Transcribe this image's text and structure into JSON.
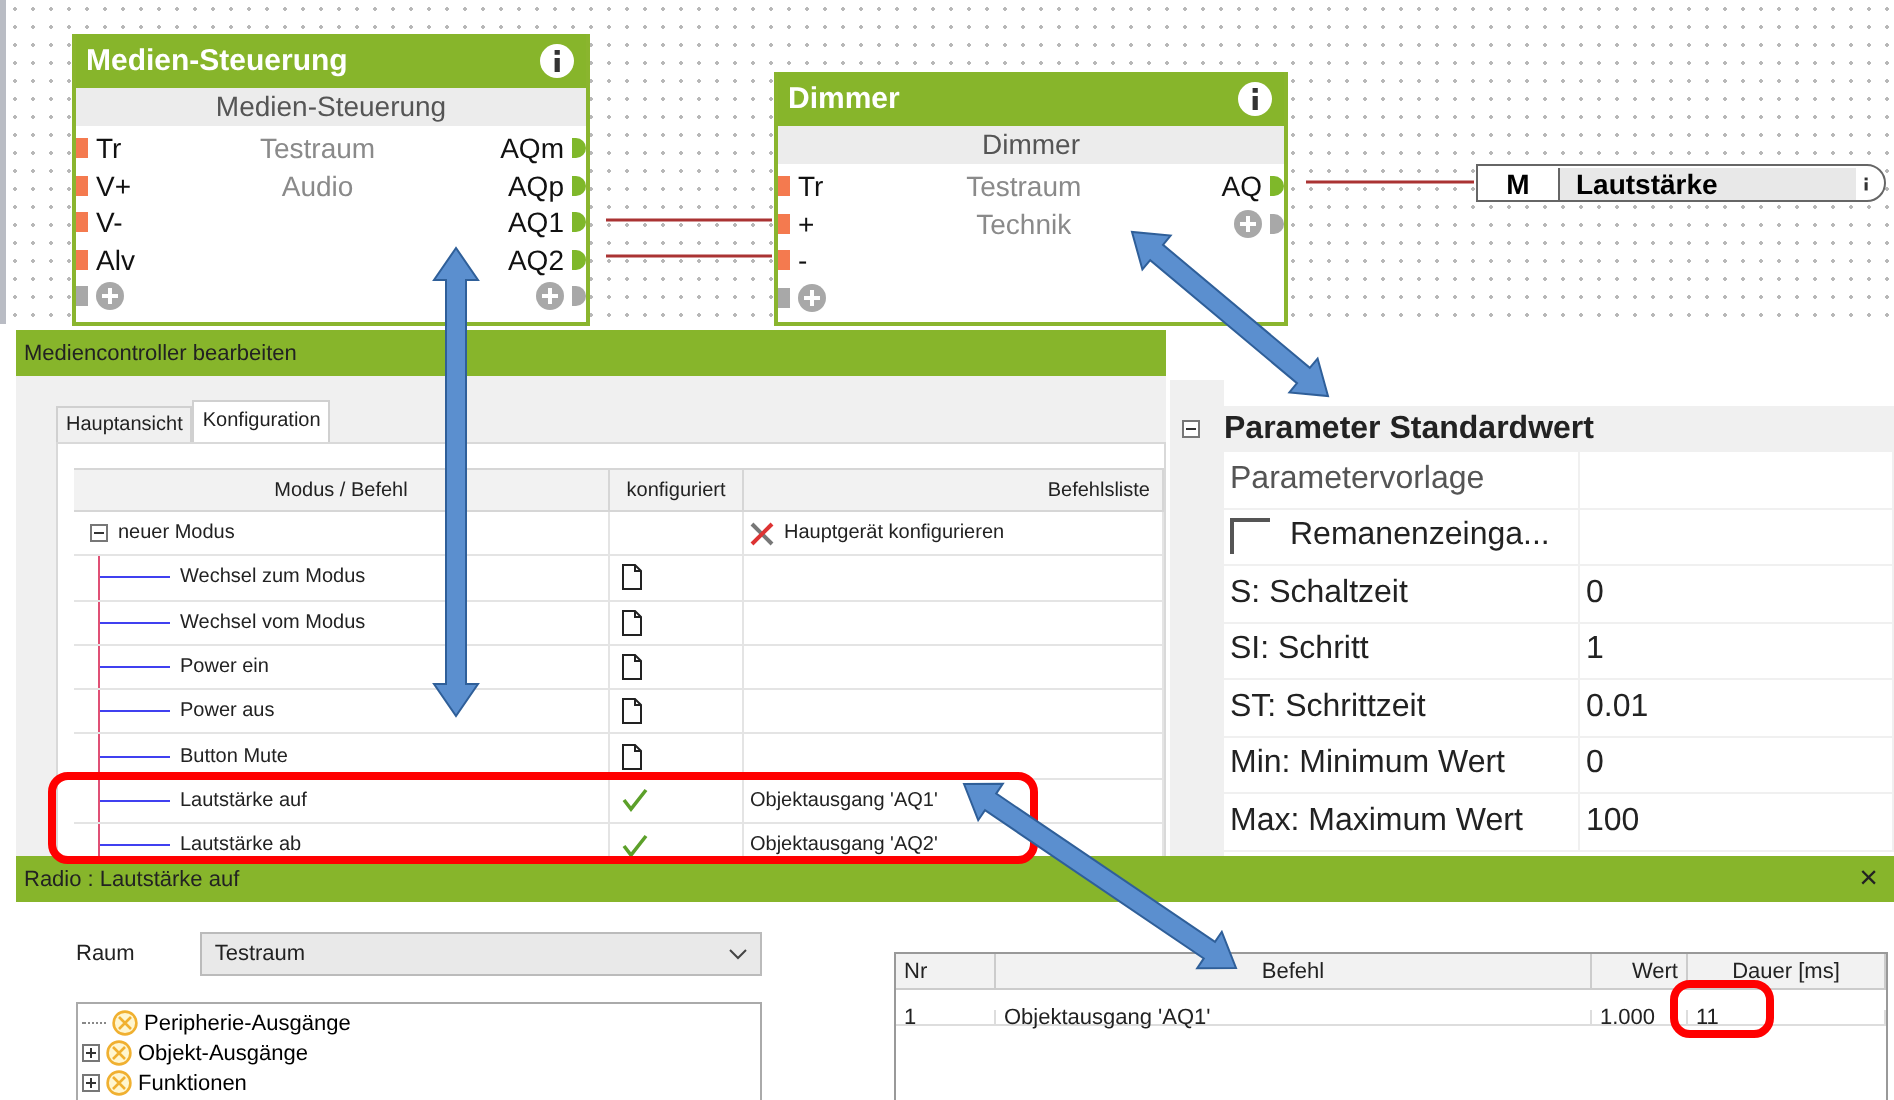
{
  "canvas": {
    "blocks": [
      {
        "title": "Medien-Steuerung",
        "subtitle": "Medien-Steuerung",
        "inputs": [
          "Tr",
          "V+",
          "V-",
          "Alv"
        ],
        "info": [
          "Testraum",
          "Audio"
        ],
        "outputs": [
          "AQm",
          "AQp",
          "AQ1",
          "AQ2"
        ]
      },
      {
        "title": "Dimmer",
        "subtitle": "Dimmer",
        "inputs": [
          "Tr",
          "+",
          "-"
        ],
        "info": [
          "Testraum",
          "Technik"
        ],
        "outputs": [
          "AQ"
        ]
      }
    ],
    "output_tag": {
      "prefix": "M",
      "label": "Lautstärke"
    }
  },
  "editor": {
    "title": "Mediencontroller bearbeiten",
    "tabs": [
      {
        "label": "Hauptansicht",
        "selected": false
      },
      {
        "label": "Konfiguration",
        "selected": true
      }
    ],
    "columns": [
      "Modus / Befehl",
      "konfiguriert",
      "Befehlsliste"
    ],
    "mode": {
      "label": "neuer Modus",
      "expanded": true,
      "command": "Hauptgerät konfigurieren",
      "children": [
        {
          "label": "Wechsel zum Modus",
          "configured": false
        },
        {
          "label": "Wechsel vom Modus",
          "configured": false
        },
        {
          "label": "Power ein",
          "configured": false
        },
        {
          "label": "Power aus",
          "configured": false
        },
        {
          "label": "Button Mute",
          "configured": false
        },
        {
          "label": "Lautstärke auf",
          "configured": true,
          "command": "Objektausgang 'AQ1'"
        },
        {
          "label": "Lautstärke ab",
          "configured": true,
          "command": "Objektausgang 'AQ2'"
        }
      ]
    }
  },
  "properties": {
    "title": "Parameter Standardwert",
    "expanded": true,
    "rows": [
      {
        "kind": "text",
        "label": "Parametervorlage"
      },
      {
        "kind": "checkbox",
        "label": "Remanenzeinga...",
        "checked": false
      },
      {
        "kind": "text",
        "label": "S: Schaltzeit",
        "value": "0"
      },
      {
        "kind": "text",
        "label": "SI: Schritt",
        "value": "1"
      },
      {
        "kind": "text",
        "label": "ST: Schrittzeit",
        "value": "0.01"
      },
      {
        "kind": "text",
        "label": "Min: Minimum Wert",
        "value": "0"
      },
      {
        "kind": "text",
        "label": "Max: Maximum Wert",
        "value": "100"
      }
    ]
  },
  "radio": {
    "title": "Radio : Lautstärke auf",
    "close": "×",
    "room_label": "Raum",
    "room": "Testraum",
    "tree": [
      {
        "label": "Peripherie-Ausgänge",
        "kind": "leaf"
      },
      {
        "label": "Objekt-Ausgänge",
        "kind": "folder",
        "expanded": false
      },
      {
        "label": "Funktionen",
        "kind": "folder",
        "expanded": false
      }
    ],
    "columns": [
      "Nr",
      "Befehl",
      "Wert",
      "Dauer [ms]"
    ],
    "rows": [
      [
        "1",
        "Objektausgang 'AQ1'",
        "1.000",
        "11"
      ]
    ]
  }
}
